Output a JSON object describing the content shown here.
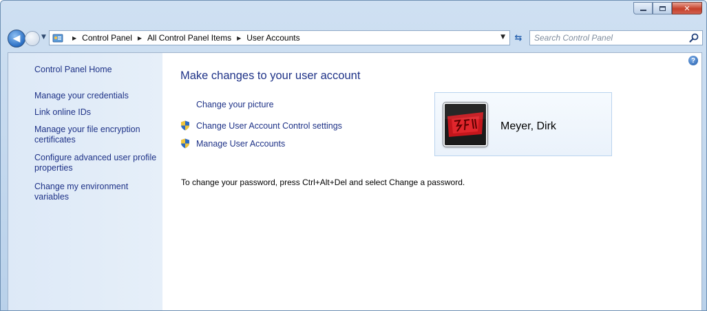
{
  "window": {
    "controls": {
      "minimize_icon": "minimize-icon",
      "maximize_icon": "maximize-icon",
      "close_icon": "close-icon"
    }
  },
  "address_bar": {
    "breadcrumbs": [
      "Control Panel",
      "All Control Panel Items",
      "User Accounts"
    ]
  },
  "search": {
    "placeholder": "Search Control Panel"
  },
  "sidebar": {
    "home": "Control Panel Home",
    "links": [
      "Manage your credentials",
      "Link online IDs",
      "Manage your file encryption certificates",
      "Configure advanced user profile properties",
      "Change my environment variables"
    ]
  },
  "main": {
    "title": "Make changes to your user account",
    "tasks": [
      "Change your picture",
      "Change User Account Control settings",
      "Manage User Accounts"
    ],
    "password_info": "To change your password, press Ctrl+Alt+Del and select Change a password."
  },
  "user": {
    "name": "Meyer, Dirk"
  },
  "colors": {
    "link": "#1e3287",
    "sidebar_bg": "#e1ecf8",
    "tile_border": "#b9d3ee"
  }
}
